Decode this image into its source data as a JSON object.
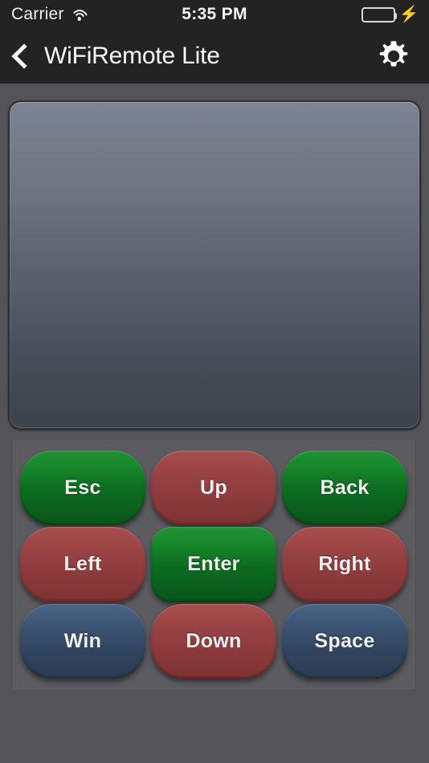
{
  "status_bar": {
    "carrier": "Carrier",
    "wifi_icon": "wifi-icon",
    "time": "5:35 PM",
    "battery_icon": "battery-icon",
    "battery_level_percent": 100,
    "charging_icon": "lightning-bolt-icon",
    "background_color": "#232324"
  },
  "nav_bar": {
    "back_icon": "chevron-left-icon",
    "title": "WiFiRemote Lite",
    "settings_icon": "gear-icon",
    "background_color": "#232324",
    "title_color": "#fbfbfb"
  },
  "trackpad": {
    "name": "trackpad-surface",
    "gradient_top_color": "#7c8392",
    "gradient_bottom_color": "#3d434d",
    "border_color": "#2b2f35",
    "content": ""
  },
  "keypad": {
    "panel_color": "#5b5b60",
    "colors": {
      "green": "#16842b",
      "red": "#94403f",
      "blue": "#3a5270"
    },
    "buttons": [
      {
        "label": "Esc",
        "color": "green",
        "name": "key-esc",
        "shape": "pill"
      },
      {
        "label": "Up",
        "color": "red",
        "name": "key-up",
        "shape": "pill"
      },
      {
        "label": "Back",
        "color": "green",
        "name": "key-back",
        "shape": "pill"
      },
      {
        "label": "Left",
        "color": "red",
        "name": "key-left",
        "shape": "pill"
      },
      {
        "label": "Enter",
        "color": "green",
        "name": "key-enter",
        "shape": "rounded"
      },
      {
        "label": "Right",
        "color": "red",
        "name": "key-right",
        "shape": "pill"
      },
      {
        "label": "Win",
        "color": "blue",
        "name": "key-win",
        "shape": "pill"
      },
      {
        "label": "Down",
        "color": "red",
        "name": "key-down",
        "shape": "pill"
      },
      {
        "label": "Space",
        "color": "blue",
        "name": "key-space",
        "shape": "pill"
      }
    ]
  }
}
